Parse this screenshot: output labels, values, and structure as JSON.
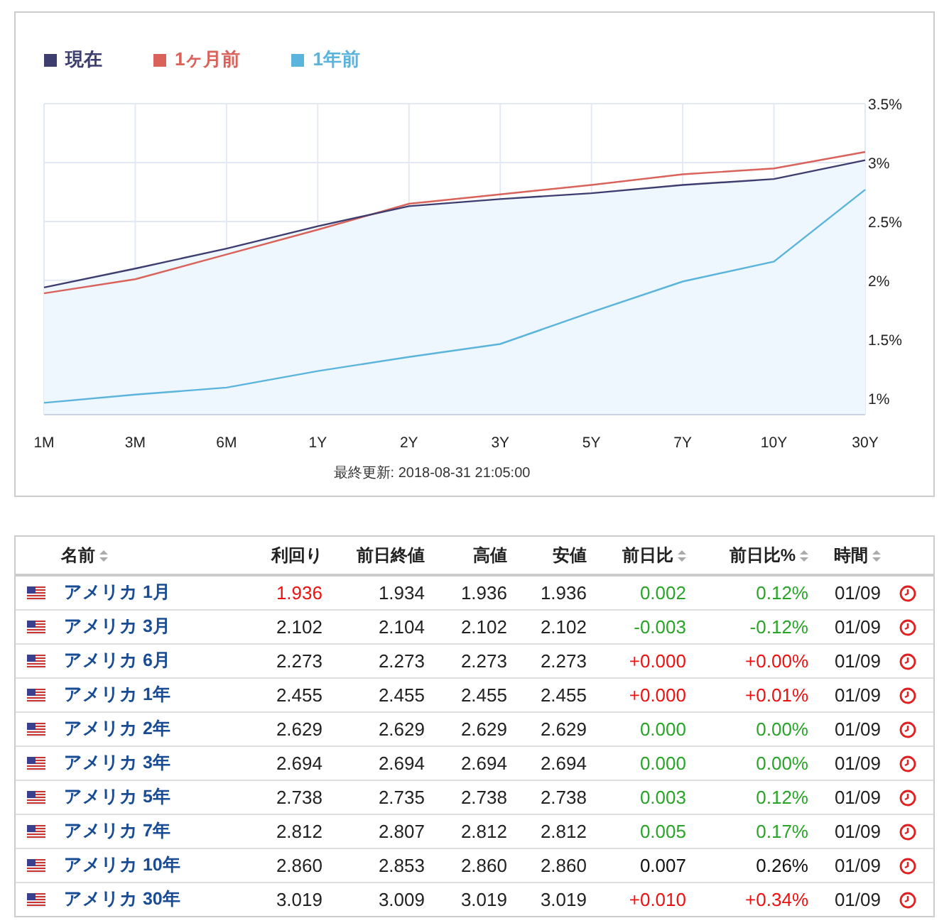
{
  "chart": {
    "chart_data": {
      "type": "line",
      "grid": true,
      "categories": [
        "1M",
        "3M",
        "6M",
        "1Y",
        "2Y",
        "3Y",
        "5Y",
        "7Y",
        "10Y",
        "30Y"
      ],
      "series": [
        {
          "name": "現在",
          "color": "#3d3d70",
          "type": "area",
          "values": [
            1.94,
            2.1,
            2.27,
            2.46,
            2.63,
            2.69,
            2.74,
            2.81,
            2.86,
            3.02
          ]
        },
        {
          "name": "1ヶ月前",
          "color": "#d9625a",
          "type": "line",
          "values": [
            1.89,
            2.01,
            2.22,
            2.43,
            2.65,
            2.73,
            2.81,
            2.9,
            2.95,
            3.09
          ]
        },
        {
          "name": "1年前",
          "color": "#5ab4dc",
          "type": "line",
          "values": [
            0.96,
            1.03,
            1.09,
            1.23,
            1.35,
            1.46,
            1.73,
            1.99,
            2.16,
            2.77
          ]
        }
      ],
      "ylim": [
        0.86,
        3.5
      ],
      "yticks": [
        {
          "value": 1,
          "label": "1%"
        },
        {
          "value": 1.5,
          "label": "1.5%"
        },
        {
          "value": 2,
          "label": "2%"
        },
        {
          "value": 2.5,
          "label": "2.5%"
        },
        {
          "value": 3,
          "label": "3%"
        },
        {
          "value": 3.5,
          "label": "3.5%"
        }
      ]
    },
    "updated": "最終更新: 2018-08-31 21:05:00"
  },
  "table": {
    "columns": [
      {
        "label": "名前",
        "sortable": true
      },
      {
        "label": "利回り",
        "sortable": false
      },
      {
        "label": "前日終値",
        "sortable": false
      },
      {
        "label": "高値",
        "sortable": false
      },
      {
        "label": "安値",
        "sortable": false
      },
      {
        "label": "前日比",
        "sortable": true
      },
      {
        "label": "前日比%",
        "sortable": true
      },
      {
        "label": "時間",
        "sortable": true
      }
    ],
    "rows": [
      {
        "name": "アメリカ 1月",
        "yield": {
          "text": "1.936",
          "color": "#ee1111"
        },
        "prev_close": "1.934",
        "high": "1.936",
        "low": "1.936",
        "change": {
          "text": "0.002",
          "color": "#2aa52a"
        },
        "change_pct": {
          "text": "0.12%",
          "color": "#2aa52a"
        },
        "time": "01/09"
      },
      {
        "name": "アメリカ 3月",
        "yield": {
          "text": "2.102",
          "color": "#222222"
        },
        "prev_close": "2.104",
        "high": "2.102",
        "low": "2.102",
        "change": {
          "text": "-0.003",
          "color": "#2aa52a"
        },
        "change_pct": {
          "text": "-0.12%",
          "color": "#2aa52a"
        },
        "time": "01/09"
      },
      {
        "name": "アメリカ 6月",
        "yield": {
          "text": "2.273",
          "color": "#222222"
        },
        "prev_close": "2.273",
        "high": "2.273",
        "low": "2.273",
        "change": {
          "text": "+0.000",
          "color": "#ee1111"
        },
        "change_pct": {
          "text": "+0.00%",
          "color": "#ee1111"
        },
        "time": "01/09"
      },
      {
        "name": "アメリカ 1年",
        "yield": {
          "text": "2.455",
          "color": "#222222"
        },
        "prev_close": "2.455",
        "high": "2.455",
        "low": "2.455",
        "change": {
          "text": "+0.000",
          "color": "#ee1111"
        },
        "change_pct": {
          "text": "+0.01%",
          "color": "#ee1111"
        },
        "time": "01/09"
      },
      {
        "name": "アメリカ 2年",
        "yield": {
          "text": "2.629",
          "color": "#222222"
        },
        "prev_close": "2.629",
        "high": "2.629",
        "low": "2.629",
        "change": {
          "text": "0.000",
          "color": "#2aa52a"
        },
        "change_pct": {
          "text": "0.00%",
          "color": "#2aa52a"
        },
        "time": "01/09"
      },
      {
        "name": "アメリカ 3年",
        "yield": {
          "text": "2.694",
          "color": "#222222"
        },
        "prev_close": "2.694",
        "high": "2.694",
        "low": "2.694",
        "change": {
          "text": "0.000",
          "color": "#2aa52a"
        },
        "change_pct": {
          "text": "0.00%",
          "color": "#2aa52a"
        },
        "time": "01/09"
      },
      {
        "name": "アメリカ 5年",
        "yield": {
          "text": "2.738",
          "color": "#222222"
        },
        "prev_close": "2.735",
        "high": "2.738",
        "low": "2.738",
        "change": {
          "text": "0.003",
          "color": "#2aa52a"
        },
        "change_pct": {
          "text": "0.12%",
          "color": "#2aa52a"
        },
        "time": "01/09"
      },
      {
        "name": "アメリカ 7年",
        "yield": {
          "text": "2.812",
          "color": "#222222"
        },
        "prev_close": "2.807",
        "high": "2.812",
        "low": "2.812",
        "change": {
          "text": "0.005",
          "color": "#2aa52a"
        },
        "change_pct": {
          "text": "0.17%",
          "color": "#2aa52a"
        },
        "time": "01/09"
      },
      {
        "name": "アメリカ 10年",
        "yield": {
          "text": "2.860",
          "color": "#222222"
        },
        "prev_close": "2.853",
        "high": "2.860",
        "low": "2.860",
        "change": {
          "text": "0.007",
          "color": "#111111"
        },
        "change_pct": {
          "text": "0.26%",
          "color": "#111111"
        },
        "time": "01/09"
      },
      {
        "name": "アメリカ 30年",
        "yield": {
          "text": "3.019",
          "color": "#222222"
        },
        "prev_close": "3.009",
        "high": "3.019",
        "low": "3.019",
        "change": {
          "text": "+0.010",
          "color": "#ee1111"
        },
        "change_pct": {
          "text": "+0.34%",
          "color": "#ee1111"
        },
        "time": "01/09"
      }
    ]
  }
}
